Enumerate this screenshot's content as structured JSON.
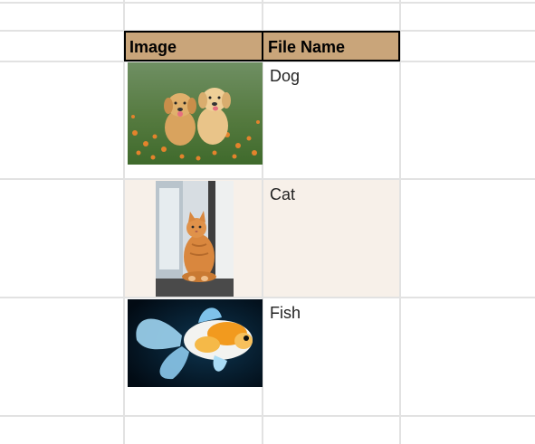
{
  "table": {
    "headers": {
      "image": "Image",
      "file_name": "File Name"
    },
    "rows": [
      {
        "file_name": "Dog",
        "image_icon": "two-puppies-photo"
      },
      {
        "file_name": "Cat",
        "image_icon": "cat-photo"
      },
      {
        "file_name": "Fish",
        "image_icon": "goldfish-photo"
      }
    ]
  },
  "colors": {
    "header_bg": "#c9a57a",
    "band_bg": "#f7f0e9",
    "gridline": "#e2e2e2"
  }
}
